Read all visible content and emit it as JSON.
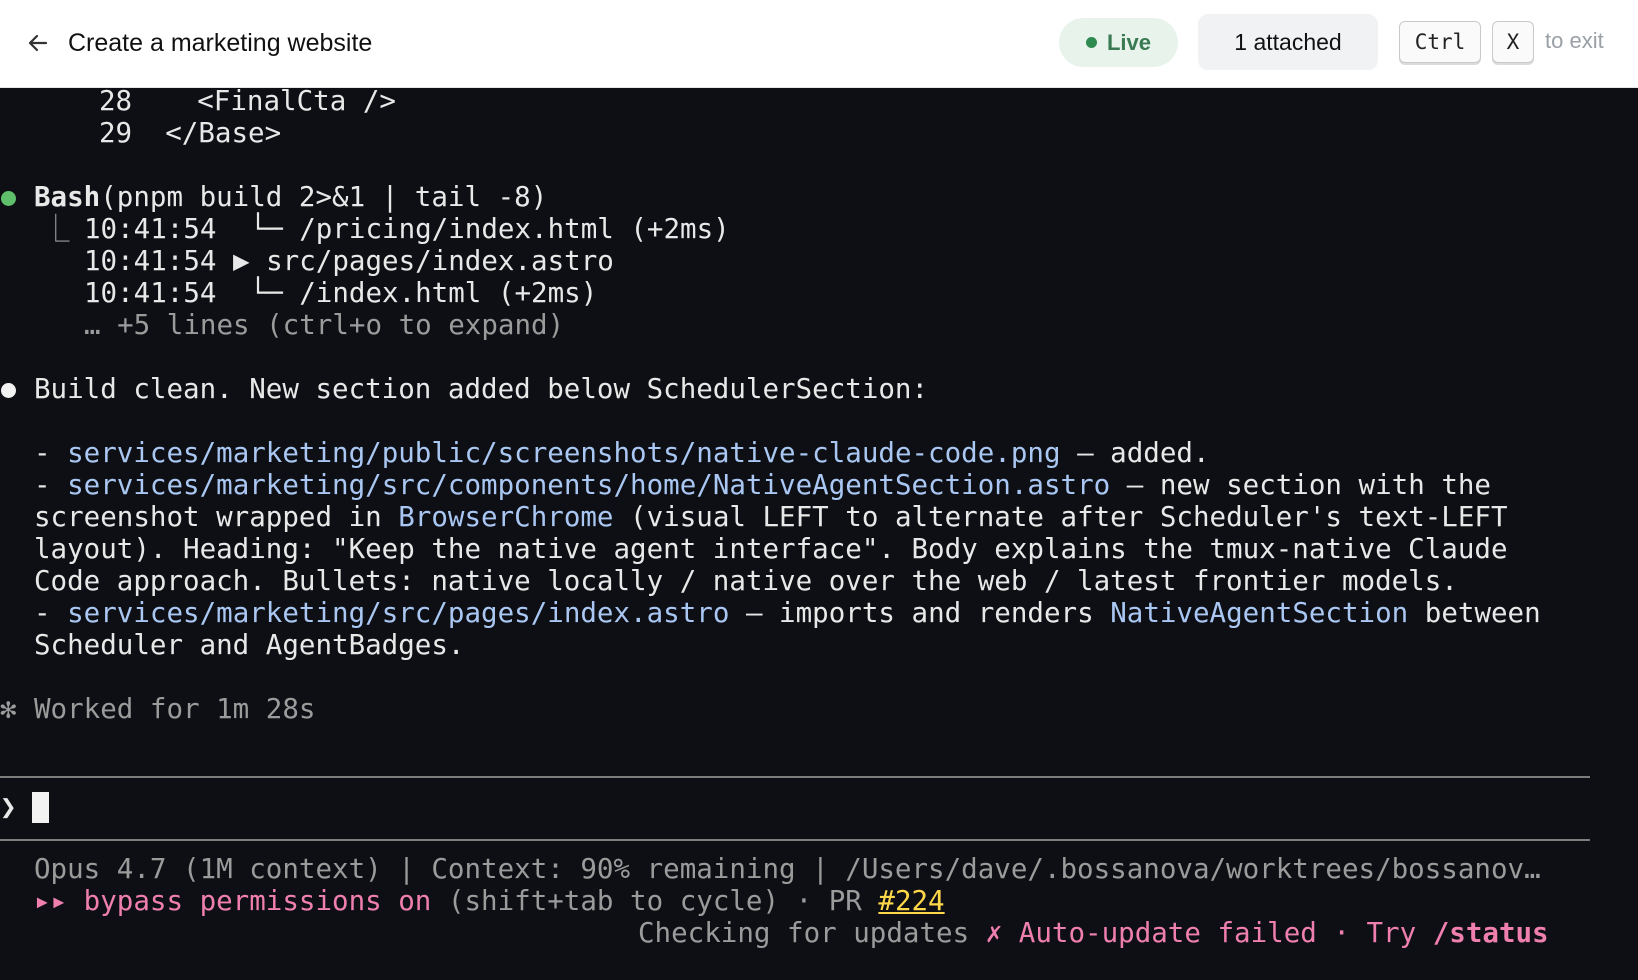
{
  "header": {
    "back_icon": "arrow-left-icon",
    "title": "Create a marketing website",
    "live_label": "Live",
    "attached_label": "1 attached",
    "kbd_ctrl": "Ctrl",
    "kbd_x": "X",
    "exit_label": "to exit"
  },
  "colors": {
    "live_dot": "#2f8a4f",
    "bash_bullet": "#5fbf6a",
    "link": "#a9c7f2",
    "pink": "#ef7fae",
    "pr_link": "#ffd84a"
  },
  "code": {
    "line28_num": "28",
    "line28_text": "<FinalCta />",
    "line29_num": "29",
    "line29_text": "</Base>"
  },
  "bash": {
    "name": "Bash",
    "args": "(pnpm build 2>&1 | tail -8)",
    "output": [
      {
        "prefix": "⎿ ",
        "time": "10:41:54",
        "text": "  └─ /pricing/index.html (+2ms)"
      },
      {
        "prefix": "  ",
        "time": "10:41:54",
        "text": " ▶ src/pages/index.astro"
      },
      {
        "prefix": "  ",
        "time": "10:41:54",
        "text": "  └─ /index.html (+2ms)"
      }
    ],
    "more": "… +5 lines (ctrl+o to expand)"
  },
  "message": {
    "intro": "Build clean. New section added below SchedulerSection:",
    "item1_path": "services/marketing/public/screenshots/native-claude-code.png",
    "item1_text": " — added.",
    "item2_path": "services/marketing/src/components/home/NativeAgentSection.astro",
    "item2_text": " — new section with the",
    "item2_line2_a": "screenshot wrapped in ",
    "item2_line2_link": "BrowserChrome",
    "item2_line2_b": " (visual LEFT to alternate after Scheduler's text-LEFT",
    "item2_line3": "layout). Heading: \"Keep the native agent interface\". Body explains the tmux-native Claude",
    "item2_line4": "Code approach. Bullets: native locally / native over the web / latest frontier models.",
    "item3_path": "services/marketing/src/pages/index.astro",
    "item3_text_a": " — imports and renders ",
    "item3_link": "NativeAgentSection",
    "item3_text_b": " between",
    "item3_line2": "Scheduler and AgentBadges."
  },
  "worked": {
    "icon": "asterisk-icon",
    "text": "Worked for 1m 28s"
  },
  "prompt": {
    "caret": "❯"
  },
  "status": {
    "line1": "Opus 4.7 (1M context) | Context: 90% remaining | /Users/dave/.bossanova/worktrees/bossanov…",
    "bypass": "▸▸ bypass permissions on",
    "cycle": " (shift+tab to cycle) · PR ",
    "pr": "#224",
    "checking": "Checking for updates ",
    "failed": "✗ Auto-update failed · Try ",
    "status_cmd": "/status"
  }
}
